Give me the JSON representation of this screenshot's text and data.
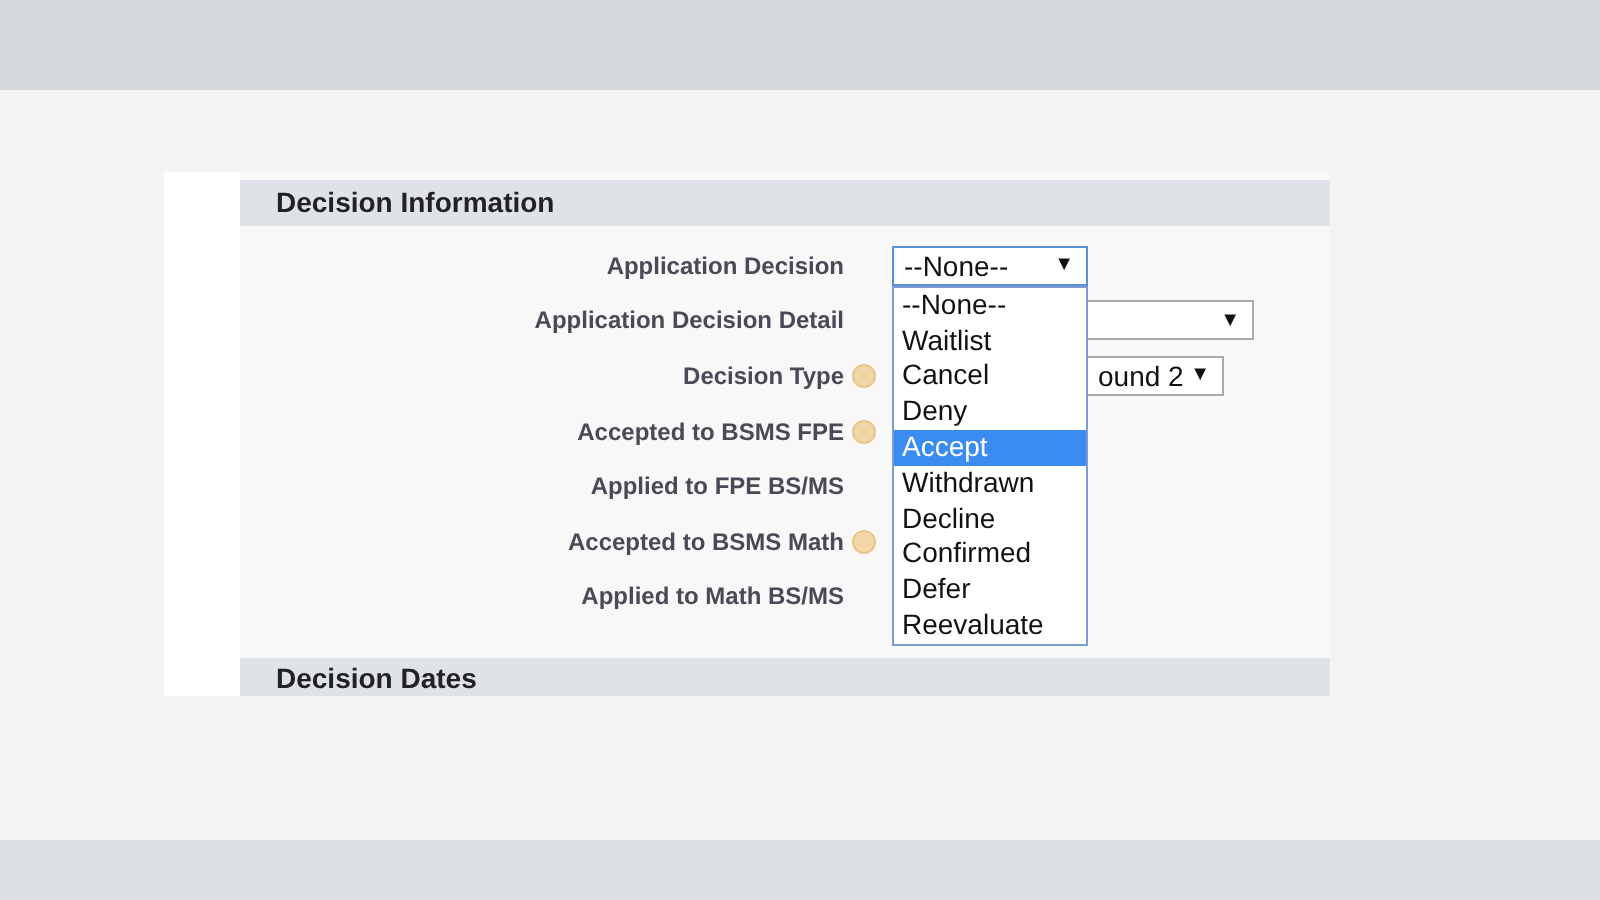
{
  "section": {
    "title": "Decision Information"
  },
  "fields": [
    {
      "label": "Application Decision",
      "help": false,
      "kind": "select",
      "value": "--None--",
      "caret": "▼",
      "open": true
    },
    {
      "label": "Application Decision Detail",
      "help": false,
      "kind": "select",
      "caret": "▼",
      "open": false
    },
    {
      "label": "Decision Type",
      "help": true,
      "kind": "select",
      "value": "ound 2",
      "caret": "▼",
      "open": false
    },
    {
      "label": "Accepted to BSMS FPE",
      "help": true,
      "kind": "text"
    },
    {
      "label": "Applied to FPE BS/MS",
      "help": false,
      "kind": "text"
    },
    {
      "label": "Accepted to BSMS Math",
      "help": true,
      "kind": "text"
    },
    {
      "label": "Applied to Math BS/MS",
      "help": false,
      "kind": "text"
    }
  ],
  "dropdown": {
    "options": [
      {
        "label": "--None--",
        "selected": false
      },
      {
        "label": "Waitlist",
        "selected": false
      },
      {
        "label": "Cancel",
        "selected": false
      },
      {
        "label": "Deny",
        "selected": false
      },
      {
        "label": "Accept",
        "selected": true
      },
      {
        "label": "Withdrawn",
        "selected": false
      },
      {
        "label": "Decline",
        "selected": false
      },
      {
        "label": "Confirmed",
        "selected": false
      },
      {
        "label": "Defer",
        "selected": false
      },
      {
        "label": "Reevaluate",
        "selected": false
      }
    ]
  },
  "next_section": {
    "title": "Decision Dates"
  }
}
